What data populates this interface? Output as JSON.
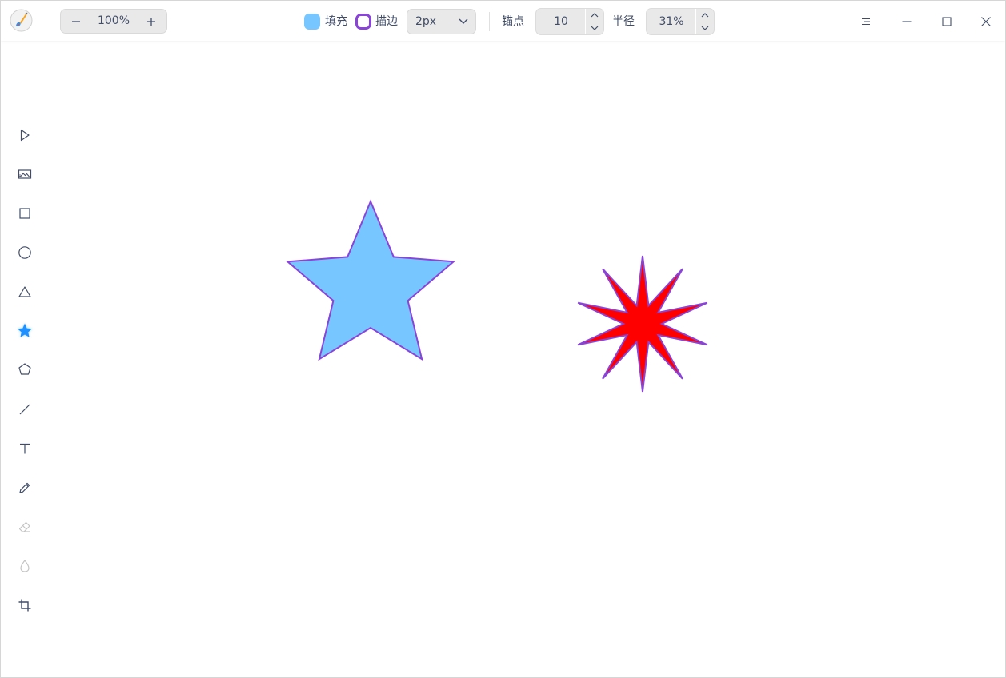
{
  "header": {
    "zoom": {
      "value": "100%"
    },
    "fill": {
      "label": "填充",
      "color": "#78c6ff"
    },
    "stroke": {
      "label": "描边",
      "color": "#8a44d8"
    },
    "stroke_width": {
      "value": "2px"
    },
    "anchor": {
      "label": "锚点",
      "value": "10"
    },
    "radius": {
      "label": "半径",
      "value": "31%"
    }
  },
  "tools": [
    {
      "id": "select",
      "icon": "cursor-icon"
    },
    {
      "id": "image",
      "icon": "image-icon"
    },
    {
      "id": "rectangle",
      "icon": "square-icon"
    },
    {
      "id": "ellipse",
      "icon": "circle-icon"
    },
    {
      "id": "triangle",
      "icon": "triangle-icon"
    },
    {
      "id": "star",
      "icon": "star-icon",
      "active": true
    },
    {
      "id": "polygon",
      "icon": "pentagon-icon"
    },
    {
      "id": "line",
      "icon": "line-icon"
    },
    {
      "id": "text",
      "icon": "text-icon"
    },
    {
      "id": "pencil",
      "icon": "pencil-icon"
    },
    {
      "id": "eraser",
      "icon": "eraser-icon",
      "disabled": true
    },
    {
      "id": "blur",
      "icon": "droplet-icon",
      "disabled": true
    },
    {
      "id": "crop",
      "icon": "crop-icon"
    }
  ],
  "canvas": {
    "shapes": [
      {
        "type": "star",
        "points": 5,
        "fill": "#78c6ff",
        "stroke": "#8a44d8",
        "stroke_width": "2px"
      },
      {
        "type": "star",
        "points": 10,
        "fill": "#ff0000",
        "stroke": "#8a44d8",
        "stroke_width": "2px"
      }
    ]
  },
  "colors": {
    "accent": "#1e90ff",
    "icon": "#414d68",
    "icon_disabled": "#c4c4c4"
  }
}
